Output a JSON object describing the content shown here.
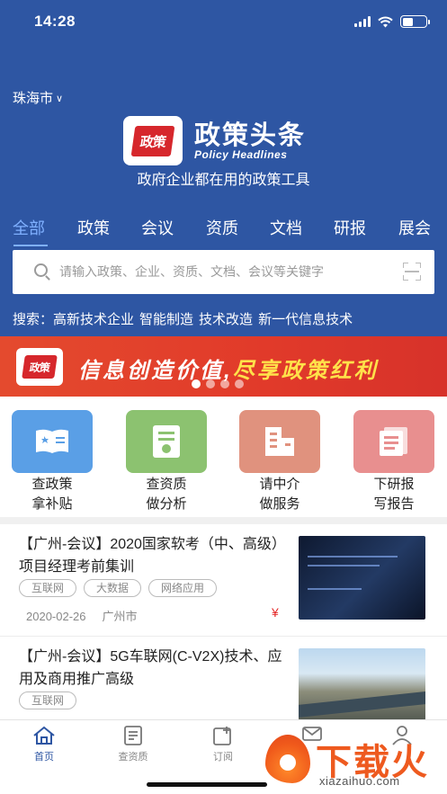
{
  "status_bar": {
    "time": "14:28"
  },
  "header": {
    "city": "珠海市",
    "brand_cn": "政策头条",
    "brand_en": "Policy Headlines",
    "logo_seal": "政策",
    "slogan": "政府企业都在用的政策工具"
  },
  "tabs": [
    "全部",
    "政策",
    "会议",
    "资质",
    "文档",
    "研报",
    "展会"
  ],
  "search": {
    "placeholder": "请输入政策、企业、资质、文档、会议等关键字"
  },
  "hot_search": {
    "label": "搜索：",
    "keywords": [
      "高新技术企业",
      "智能制造",
      "技术改造",
      "新一代信息技术"
    ]
  },
  "banner": {
    "text_white": "信息创造价值,",
    "text_yellow": "尽享政策红利",
    "slide_count": 4,
    "active_slide": 1
  },
  "services": [
    {
      "line1": "查政策",
      "line2": "拿补贴",
      "color": "#5a9fe6",
      "icon": "book-icon"
    },
    {
      "line1": "查资质",
      "line2": "做分析",
      "color": "#8cc270",
      "icon": "certificate-icon"
    },
    {
      "line1": "请中介",
      "line2": "做服务",
      "color": "#e0927e",
      "icon": "building-icon"
    },
    {
      "line1": "下研报",
      "line2": "写报告",
      "color": "#e88f8f",
      "icon": "report-icon"
    }
  ],
  "news": [
    {
      "title": "【广州-会议】2020国家软考（中、高级）项目经理考前集训",
      "tags": [
        "互联网",
        "大数据",
        "网络应用"
      ],
      "date": "2020-02-26",
      "location": "广州市",
      "price_symbol": "¥"
    },
    {
      "title": "【广州-会议】5G车联网(C-V2X)技术、应用及商用推广高级",
      "tags": [
        "互联网"
      ]
    }
  ],
  "tabbar": [
    {
      "label": "首页",
      "icon": "home-icon",
      "active": true
    },
    {
      "label": "查资质",
      "icon": "certificate-icon",
      "active": false
    },
    {
      "label": "订阅",
      "icon": "subscribe-icon",
      "active": false
    },
    {
      "label": "",
      "icon": "message-icon",
      "active": false
    },
    {
      "label": "",
      "icon": "user-icon",
      "active": false
    }
  ],
  "watermark": {
    "big": "下载火",
    "small": "xiazaihuo.com"
  }
}
